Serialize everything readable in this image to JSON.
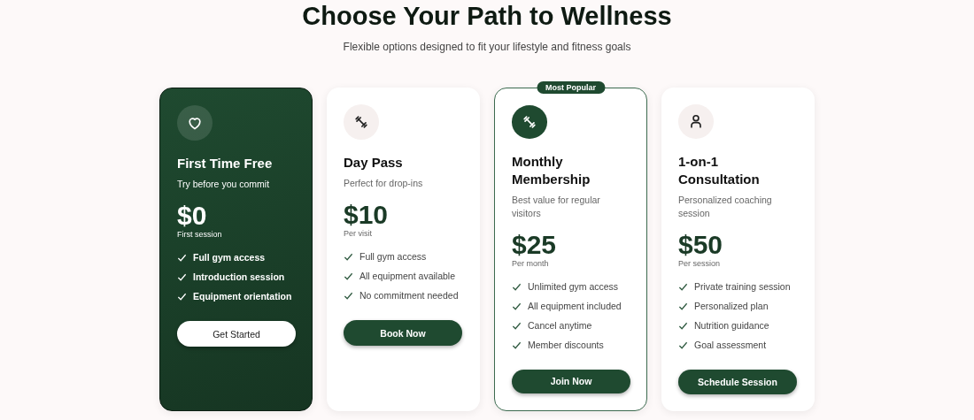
{
  "heading": "Choose Your Path to Wellness",
  "subheading": "Flexible options designed to fit your lifestyle and fitness goals",
  "plans": [
    {
      "kind": "featured",
      "title": "First Time Free",
      "subtitle": "Try before you commit",
      "price": "$0",
      "period": "First session",
      "features": [
        "Full gym access",
        "Introduction session",
        "Equipment orientation"
      ],
      "button": "Get Started"
    },
    {
      "kind": "standard",
      "title": "Day Pass",
      "subtitle": "Perfect for drop-ins",
      "price": "$10",
      "period": "Per visit",
      "features": [
        "Full gym access",
        "All equipment available",
        "No commitment needed"
      ],
      "button": "Book Now"
    },
    {
      "kind": "popular",
      "badge": "Most Popular",
      "title": "Monthly Membership",
      "subtitle": "Best value for regular visitors",
      "price": "$25",
      "period": "Per month",
      "features": [
        "Unlimited gym access",
        "All equipment included",
        "Cancel anytime",
        "Member discounts"
      ],
      "button": "Join Now"
    },
    {
      "kind": "standard",
      "title": "1-on-1 Consultation",
      "subtitle": "Personalized coaching session",
      "price": "$50",
      "period": "Per session",
      "features": [
        "Private training session",
        "Personalized plan",
        "Nutrition guidance",
        "Goal assessment"
      ],
      "button": "Schedule Session"
    }
  ]
}
